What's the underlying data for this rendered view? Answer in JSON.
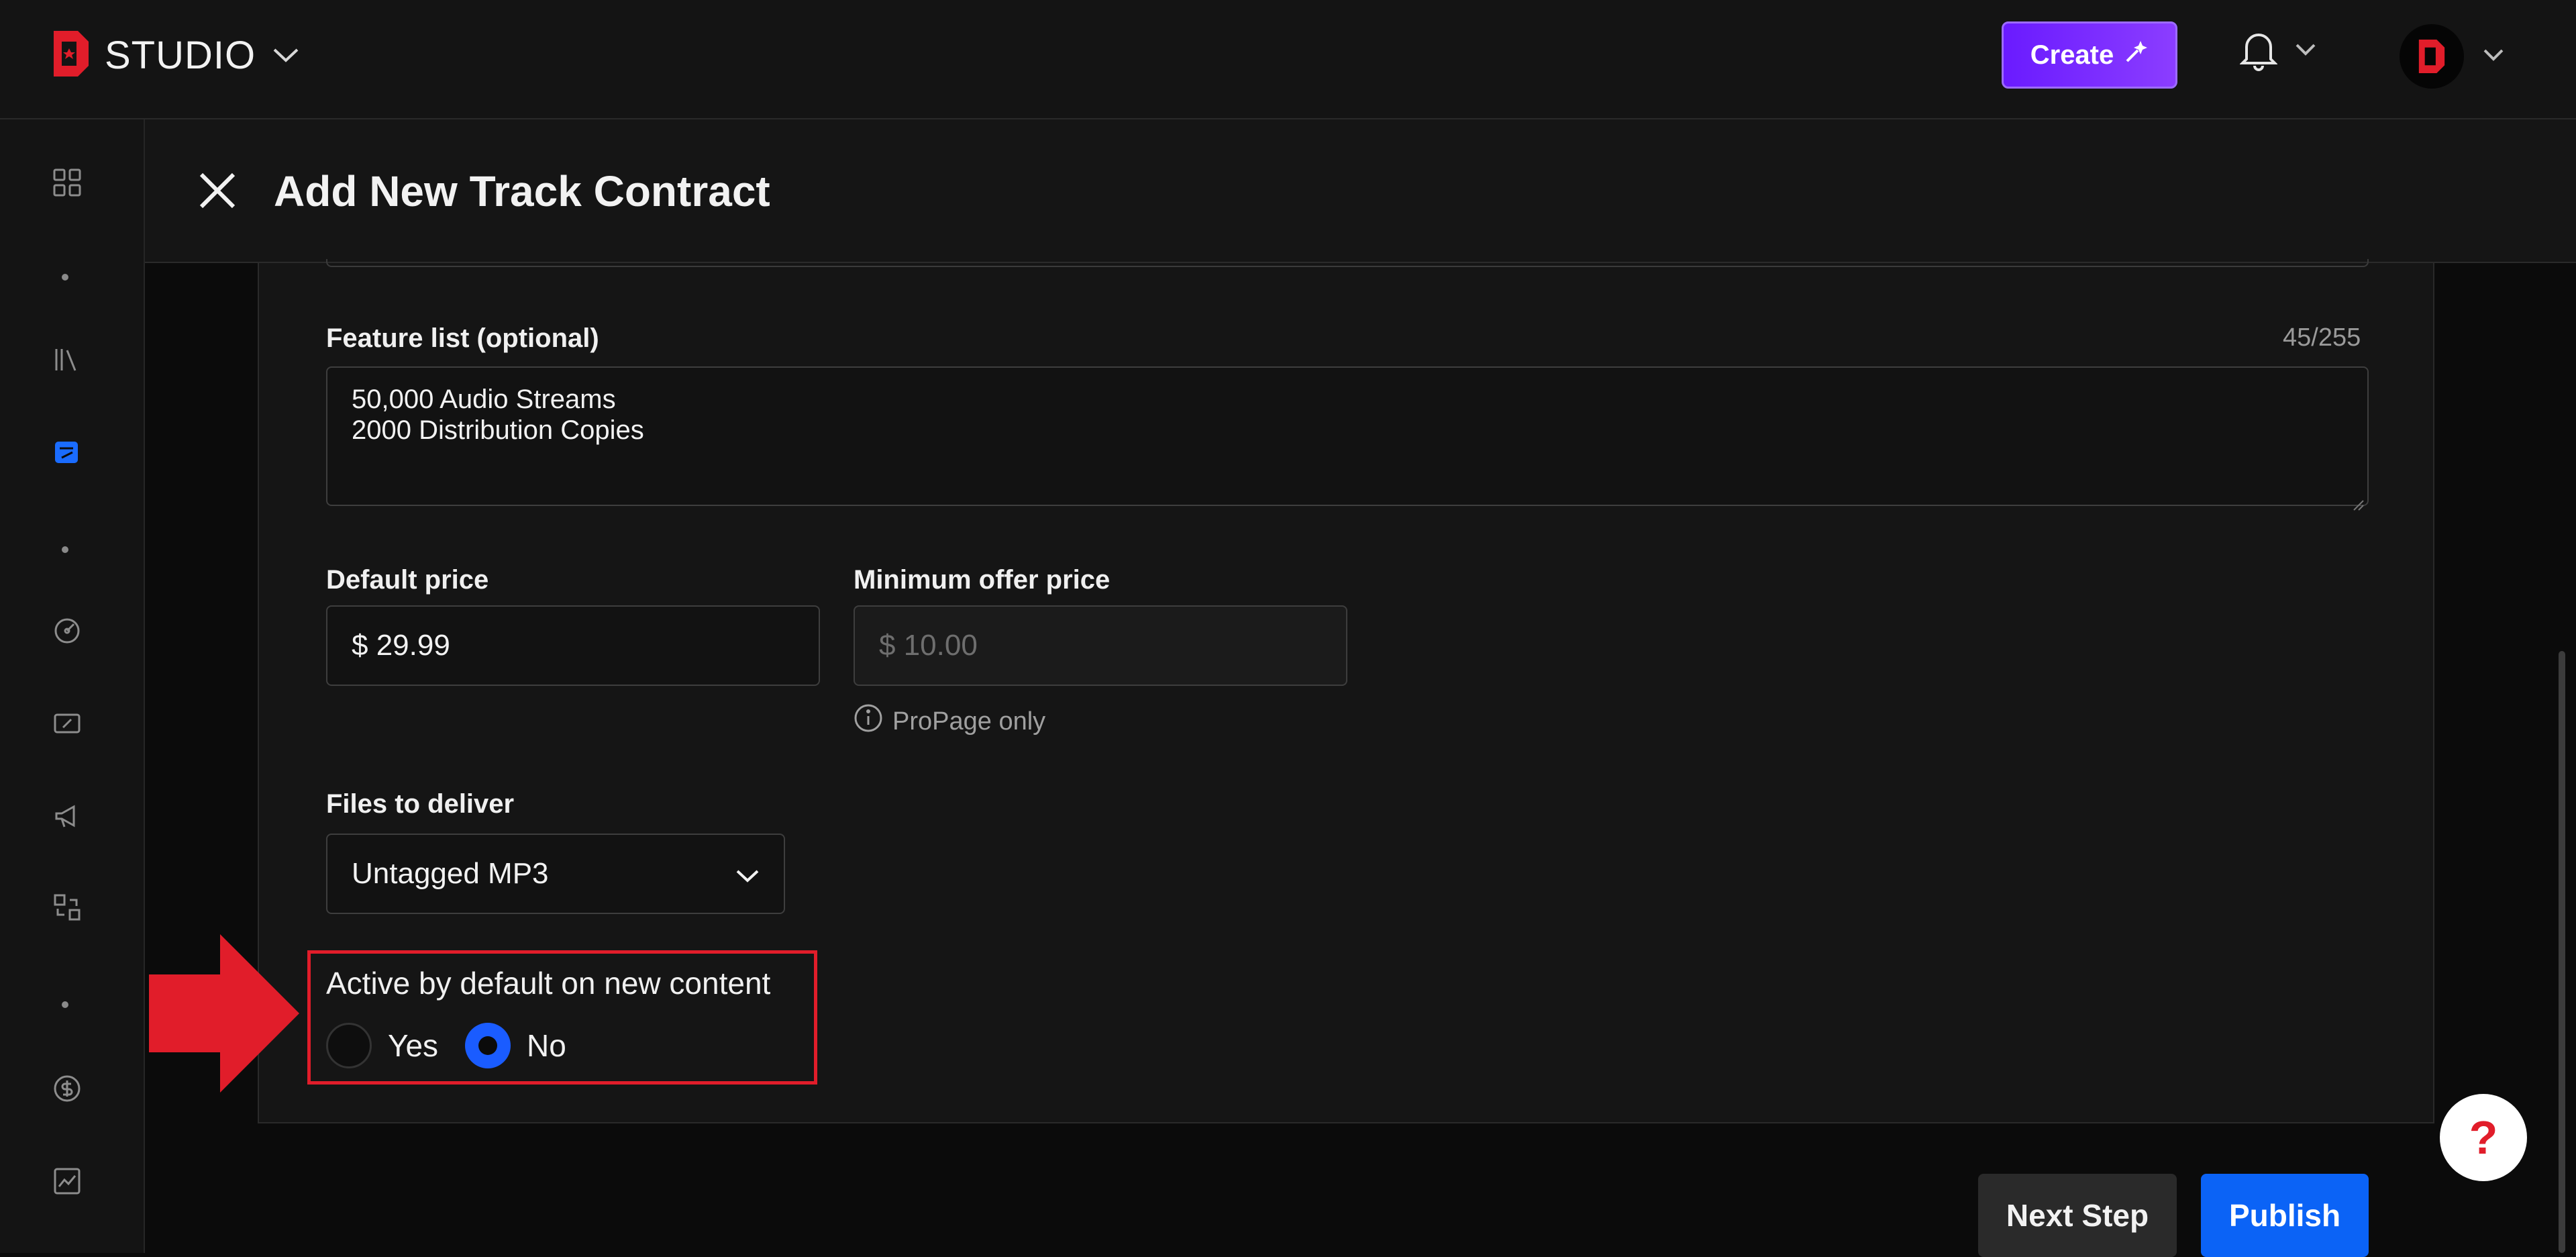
{
  "app": {
    "brand": "STUDIO"
  },
  "header": {
    "create_label": "Create"
  },
  "modal": {
    "title": "Add New Track Contract"
  },
  "form": {
    "feature_list": {
      "label": "Feature list (optional)",
      "counter": "45/255",
      "lines": [
        "50,000 Audio Streams",
        "2000 Distribution Copies"
      ]
    },
    "default_price": {
      "label": "Default price",
      "value": "$ 29.99"
    },
    "minimum_offer": {
      "label": "Minimum offer price",
      "placeholder": "$ 10.00",
      "hint": "ProPage only"
    },
    "files_to_deliver": {
      "label": "Files to deliver",
      "selected": "Untagged MP3"
    },
    "active_default": {
      "label": "Active by default on new content",
      "options": [
        "Yes",
        "No"
      ],
      "selected": "No"
    }
  },
  "footer": {
    "next_label": "Next Step",
    "publish_label": "Publish"
  },
  "help": {
    "label": "?"
  },
  "colors": {
    "accent": "#0b63f6",
    "create": "#7b2cff",
    "highlight": "#e11d2a"
  }
}
